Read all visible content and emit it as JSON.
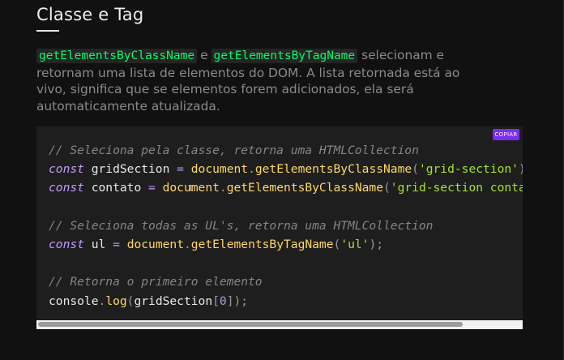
{
  "section": {
    "title": "Classe e Tag"
  },
  "description": {
    "code1": "getElementsByClassName",
    "conj": "e",
    "code2": "getElementsByTagName",
    "text": "selecionam e retornam uma lista de elementos do DOM. A lista retornada está ao vivo, significa que se elementos forem adicionados, ela será automaticamente atualizada."
  },
  "code_block": {
    "copy_label": "COPIAR",
    "lines": [
      [
        {
          "t": "cm",
          "v": "// Seleciona pela classe, retorna uma HTMLCollection"
        }
      ],
      [
        {
          "t": "kw",
          "v": "const"
        },
        {
          "t": "id",
          "v": " gridSection "
        },
        {
          "t": "op",
          "v": "="
        },
        {
          "t": "id",
          "v": " "
        },
        {
          "t": "fn",
          "v": "document"
        },
        {
          "t": "pn",
          "v": "."
        },
        {
          "t": "fn",
          "v": "getElementsByClassName"
        },
        {
          "t": "pn",
          "v": "("
        },
        {
          "t": "st",
          "v": "'grid-section'"
        },
        {
          "t": "pn",
          "v": ");"
        }
      ],
      [
        {
          "t": "kw",
          "v": "const"
        },
        {
          "t": "id",
          "v": " contato "
        },
        {
          "t": "op",
          "v": "="
        },
        {
          "t": "id",
          "v": " "
        },
        {
          "t": "fn",
          "v": "document"
        },
        {
          "t": "pn",
          "v": "."
        },
        {
          "t": "fn",
          "v": "getElementsByClassName"
        },
        {
          "t": "pn",
          "v": "("
        },
        {
          "t": "st",
          "v": "'grid-section contato'"
        },
        {
          "t": "pn",
          "v": ");"
        }
      ],
      [],
      [
        {
          "t": "cm",
          "v": "// Seleciona todas as UL's, retorna uma HTMLCollection"
        }
      ],
      [
        {
          "t": "kw",
          "v": "const"
        },
        {
          "t": "id",
          "v": " ul "
        },
        {
          "t": "op",
          "v": "="
        },
        {
          "t": "id",
          "v": " "
        },
        {
          "t": "fn",
          "v": "document"
        },
        {
          "t": "pn",
          "v": "."
        },
        {
          "t": "fn",
          "v": "getElementsByTagName"
        },
        {
          "t": "pn",
          "v": "("
        },
        {
          "t": "st",
          "v": "'ul'"
        },
        {
          "t": "pn",
          "v": ");"
        }
      ],
      [],
      [
        {
          "t": "cm",
          "v": "// Retorna o primeiro elemento"
        }
      ],
      [
        {
          "t": "id",
          "v": "console"
        },
        {
          "t": "pn",
          "v": "."
        },
        {
          "t": "fn",
          "v": "log"
        },
        {
          "t": "pn",
          "v": "("
        },
        {
          "t": "id",
          "v": "gridSection"
        },
        {
          "t": "pn",
          "v": "["
        },
        {
          "t": "nm",
          "v": "0"
        },
        {
          "t": "pn",
          "v": "]);"
        }
      ]
    ]
  },
  "scrollbar": {
    "visible_fraction": 0.88,
    "position_fraction": 0.0
  }
}
